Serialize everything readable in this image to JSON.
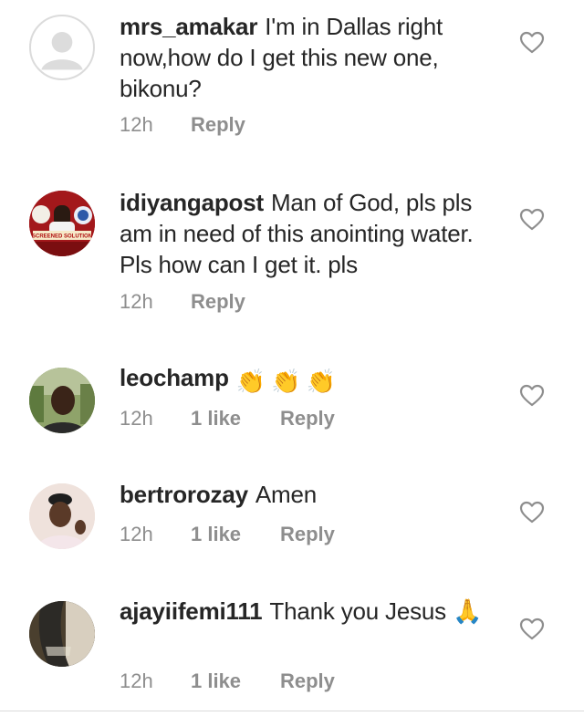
{
  "comments": [
    {
      "username": "mrs_amakar",
      "text": "I'm in Dallas right now,how do I get this new one, bikonu?",
      "time": "12h",
      "likes": "",
      "reply": "Reply",
      "avatar": "default-avatar-icon"
    },
    {
      "username": "idiyangapost",
      "text": "Man of God, pls pls am in need of this anointing water. Pls how can I get it. pls",
      "time": "12h",
      "likes": "",
      "reply": "Reply",
      "avatar": "profile-photo",
      "avatar_badge_text": "SCREENED SOLUTION"
    },
    {
      "username": "leochamp",
      "text": "👏👏👏",
      "time": "12h",
      "likes": "1 like",
      "reply": "Reply",
      "avatar": "profile-photo"
    },
    {
      "username": "bertrorozay",
      "text": "Amen",
      "time": "12h",
      "likes": "1 like",
      "reply": "Reply",
      "avatar": "profile-photo"
    },
    {
      "username": "ajayiifemi111",
      "text": "Thank you Jesus 🙏",
      "time": "12h",
      "likes": "1 like",
      "reply": "Reply",
      "avatar": "profile-photo"
    }
  ],
  "icons": {
    "like": "heart-outline-icon"
  },
  "colors": {
    "text": "#262626",
    "meta": "#8e8e8e",
    "heart": "#8e8e8e",
    "divider": "#dbdbdb"
  }
}
